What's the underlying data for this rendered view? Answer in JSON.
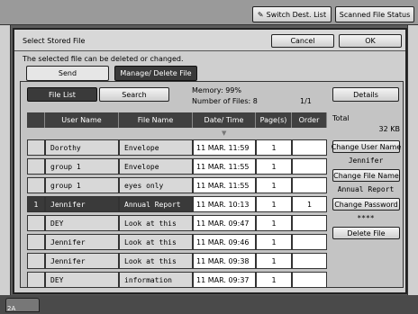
{
  "top_bar": {
    "switch_dest_label": "Switch Dest. List",
    "scanned_status_label": "Scanned File Status"
  },
  "dialog": {
    "title": "Select Stored File",
    "cancel_label": "Cancel",
    "ok_label": "OK",
    "message": "The selected file can be deleted or changed.",
    "tabs": [
      {
        "label": "Send"
      },
      {
        "label": "Manage/ Delete File"
      }
    ]
  },
  "toolbar": {
    "file_list_label": "File List",
    "search_label": "Search",
    "memory_text": "Memory: 99%",
    "num_files_text": "Number of Files: 8",
    "page_text": "1/1",
    "details_label": "Details"
  },
  "table": {
    "headers": [
      "User Name",
      "File Name",
      "Date/ Time",
      "Page(s)",
      "Order"
    ],
    "rows": [
      {
        "user": "Dorothy",
        "file": "Envelope",
        "date": "11 MAR. 11:59",
        "pages": "1",
        "order": ""
      },
      {
        "user": "group 1",
        "file": "Envelope",
        "date": "11 MAR. 11:55",
        "pages": "1",
        "order": ""
      },
      {
        "user": "group 1",
        "file": "eyes only",
        "date": "11 MAR. 11:55",
        "pages": "1",
        "order": ""
      },
      {
        "user": "Jennifer",
        "file": "Annual Report",
        "date": "11 MAR. 10:13",
        "pages": "1",
        "order": "1"
      },
      {
        "user": "DEY",
        "file": "Look at this",
        "date": "11 MAR. 09:47",
        "pages": "1",
        "order": ""
      },
      {
        "user": "Jennifer",
        "file": "Look at this",
        "date": "11 MAR. 09:46",
        "pages": "1",
        "order": ""
      },
      {
        "user": "Jennifer",
        "file": "Look at this",
        "date": "11 MAR. 09:38",
        "pages": "1",
        "order": ""
      },
      {
        "user": "DEY",
        "file": "information",
        "date": "11 MAR. 09:37",
        "pages": "1",
        "order": ""
      }
    ],
    "selected_index": 3,
    "selected_marker": "1"
  },
  "side_panel": {
    "total_label": "Total",
    "total_value": "32 KB",
    "change_user_label": "Change User Name",
    "user_value": "Jennifer",
    "change_file_label": "Change File Name",
    "file_value": "Annual Report",
    "change_password_label": "Change Password",
    "password_value": "****",
    "delete_label": "Delete File"
  },
  "status": {
    "tray_label": "2A"
  }
}
